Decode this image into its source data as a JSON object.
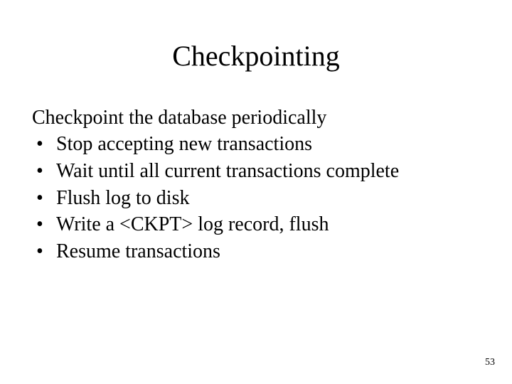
{
  "slide": {
    "title": "Checkpointing",
    "intro": "Checkpoint the database periodically",
    "bullets": [
      "Stop accepting new transactions",
      "Wait until all current transactions complete",
      "Flush log to disk",
      "Write a <CKPT> log record, flush",
      "Resume transactions"
    ],
    "page_number": "53"
  }
}
